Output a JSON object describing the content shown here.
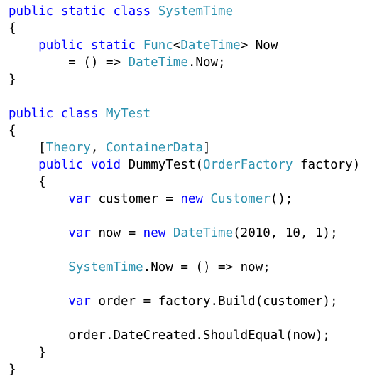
{
  "colors": {
    "keyword": "#0000ff",
    "type": "#2b91af",
    "plain": "#000000",
    "background": "#ffffff"
  },
  "code": {
    "lines": [
      [
        [
          "k",
          "public"
        ],
        [
          "p",
          " "
        ],
        [
          "k",
          "static"
        ],
        [
          "p",
          " "
        ],
        [
          "k",
          "class"
        ],
        [
          "p",
          " "
        ],
        [
          "t",
          "SystemTime"
        ]
      ],
      [
        [
          "p",
          "{"
        ]
      ],
      [
        [
          "p",
          "    "
        ],
        [
          "k",
          "public"
        ],
        [
          "p",
          " "
        ],
        [
          "k",
          "static"
        ],
        [
          "p",
          " "
        ],
        [
          "t",
          "Func"
        ],
        [
          "p",
          "<"
        ],
        [
          "t",
          "DateTime"
        ],
        [
          "p",
          "> Now"
        ]
      ],
      [
        [
          "p",
          "        = () => "
        ],
        [
          "t",
          "DateTime"
        ],
        [
          "p",
          ".Now;"
        ]
      ],
      [
        [
          "p",
          "}"
        ]
      ],
      [],
      [
        [
          "k",
          "public"
        ],
        [
          "p",
          " "
        ],
        [
          "k",
          "class"
        ],
        [
          "p",
          " "
        ],
        [
          "t",
          "MyTest"
        ]
      ],
      [
        [
          "p",
          "{"
        ]
      ],
      [
        [
          "p",
          "    ["
        ],
        [
          "t",
          "Theory"
        ],
        [
          "p",
          ", "
        ],
        [
          "t",
          "ContainerData"
        ],
        [
          "p",
          "]"
        ]
      ],
      [
        [
          "p",
          "    "
        ],
        [
          "k",
          "public"
        ],
        [
          "p",
          " "
        ],
        [
          "k",
          "void"
        ],
        [
          "p",
          " DummyTest("
        ],
        [
          "t",
          "OrderFactory"
        ],
        [
          "p",
          " factory)"
        ]
      ],
      [
        [
          "p",
          "    {"
        ]
      ],
      [
        [
          "p",
          "        "
        ],
        [
          "k",
          "var"
        ],
        [
          "p",
          " customer = "
        ],
        [
          "k",
          "new"
        ],
        [
          "p",
          " "
        ],
        [
          "t",
          "Customer"
        ],
        [
          "p",
          "();"
        ]
      ],
      [],
      [
        [
          "p",
          "        "
        ],
        [
          "k",
          "var"
        ],
        [
          "p",
          " now = "
        ],
        [
          "k",
          "new"
        ],
        [
          "p",
          " "
        ],
        [
          "t",
          "DateTime"
        ],
        [
          "p",
          "(2010, 10, 1);"
        ]
      ],
      [],
      [
        [
          "p",
          "        "
        ],
        [
          "t",
          "SystemTime"
        ],
        [
          "p",
          ".Now = () => now;"
        ]
      ],
      [],
      [
        [
          "p",
          "        "
        ],
        [
          "k",
          "var"
        ],
        [
          "p",
          " order = factory.Build(customer);"
        ]
      ],
      [],
      [
        [
          "p",
          "        order.DateCreated.ShouldEqual(now);"
        ]
      ],
      [
        [
          "p",
          "    }"
        ]
      ],
      [
        [
          "p",
          "}"
        ]
      ]
    ]
  }
}
